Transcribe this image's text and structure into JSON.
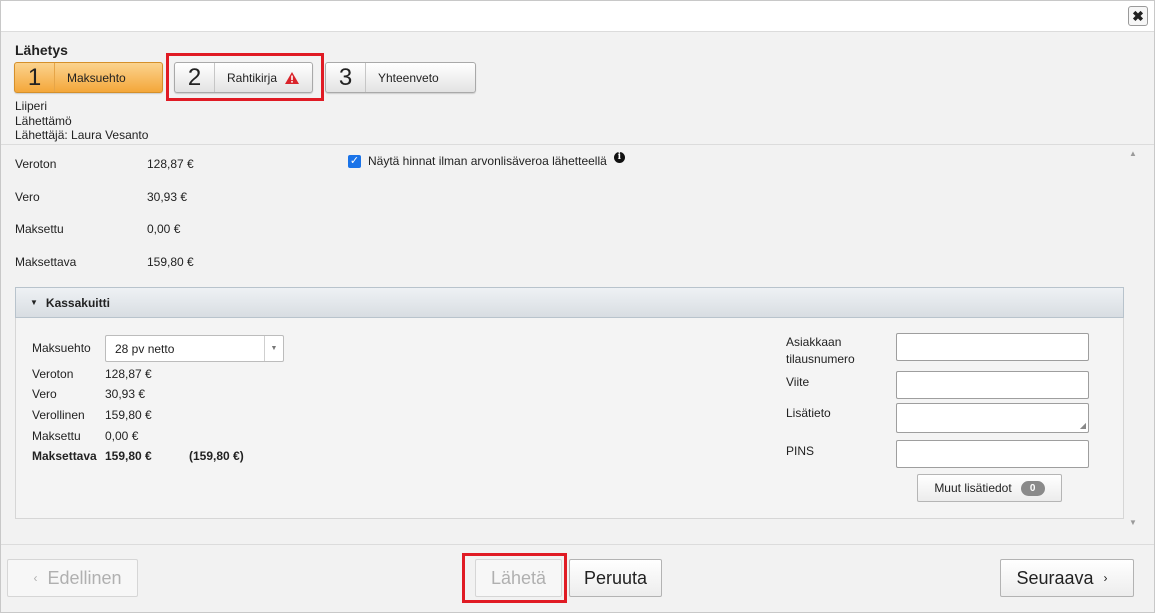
{
  "dialog": {
    "close_icon": "✖",
    "section_title": "Lähetys"
  },
  "steps": [
    {
      "number": "1",
      "label": "Maksuehto",
      "state": "active"
    },
    {
      "number": "2",
      "label": "Rahtikirja",
      "state": "warning"
    },
    {
      "number": "3",
      "label": "Yhteenveto",
      "state": "default"
    }
  ],
  "info": {
    "line1": "Liiperi",
    "line2": "Lähettämö",
    "line3": "Lähettäjä: Laura Vesanto"
  },
  "summary": [
    {
      "label": "Veroton",
      "value": "128,87 €"
    },
    {
      "label": "Vero",
      "value": "30,93 €"
    },
    {
      "label": "Maksettu",
      "value": "0,00 €"
    },
    {
      "label": "Maksettava",
      "value": "159,80 €"
    }
  ],
  "vat_option": {
    "checked": true,
    "label": "Näytä hinnat ilman arvonlisäveroa lähetteellä",
    "info_icon": "i"
  },
  "panel": {
    "title": "Kassakuitti",
    "payment_term_label": "Maksuehto",
    "payment_term_value": "28 pv netto",
    "rows": [
      {
        "label": "Veroton",
        "value": "128,87 €"
      },
      {
        "label": "Vero",
        "value": "30,93 €"
      },
      {
        "label": "Verollinen",
        "value": "159,80 €"
      },
      {
        "label": "Maksettu",
        "value": "0,00 €"
      }
    ],
    "total": {
      "label": "Maksettava",
      "value": "159,80 €",
      "extra": "(159,80 €)"
    },
    "fields": {
      "order_number_label_1": "Asiakkaan",
      "order_number_label_2": "tilausnumero",
      "reference_label": "Viite",
      "extra_info_label": "Lisätieto",
      "pins_label": "PINS",
      "order_number_value": "",
      "reference_value": "",
      "extra_info_value": "",
      "pins_value": ""
    },
    "more_info_button": "Muut lisätiedot",
    "more_info_count": "0"
  },
  "footer": {
    "previous": "Edellinen",
    "send": "Lähetä",
    "cancel": "Peruuta",
    "next": "Seuraava"
  },
  "colors": {
    "active_step": "#f4a73a",
    "highlight": "#e01b24",
    "checkbox": "#1a73e8",
    "warning": "#d9232a"
  }
}
